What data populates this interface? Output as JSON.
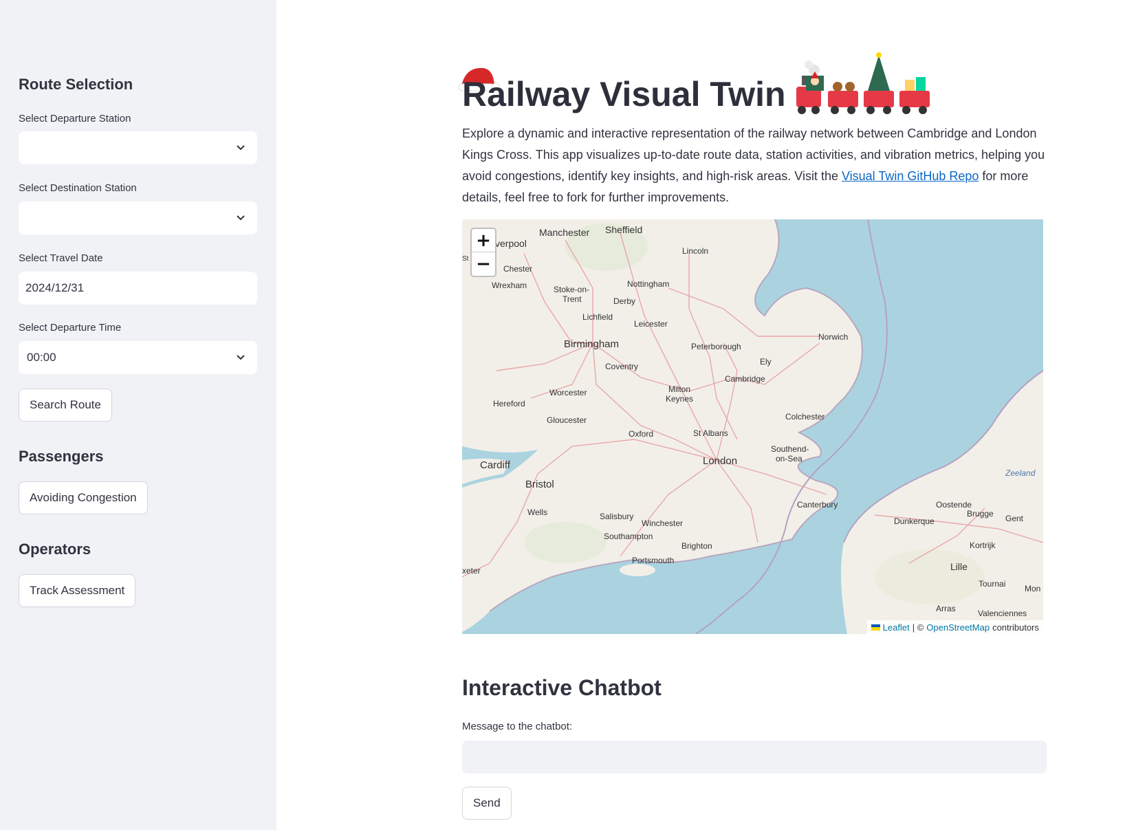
{
  "sidebar": {
    "route_heading": "Route Selection",
    "departure_label": "Select Departure Station",
    "departure_value": "",
    "destination_label": "Select Destination Station",
    "destination_value": "",
    "date_label": "Select Travel Date",
    "date_value": "2024/12/31",
    "time_label": "Select Departure Time",
    "time_value": "00:00",
    "search_button": "Search Route",
    "passengers_heading": "Passengers",
    "congestion_button": "Avoiding Congestion",
    "operators_heading": "Operators",
    "track_button": "Track Assessment"
  },
  "main": {
    "title": "Railway Visual Twin",
    "description_before_link": "Explore a dynamic and interactive representation of the railway network between Cambridge and London Kings Cross. This app visualizes up-to-date route data, station activities, and vibration metrics, helping you avoid congestions, identify key insights, and high-risk areas. Visit the ",
    "link_text": "Visual Twin GitHub Repo",
    "description_after_link": " for more details, feel free to fork for further improvements."
  },
  "map": {
    "zoom_in": "+",
    "zoom_out": "−",
    "attribution_leaflet": "Leaflet",
    "attribution_sep": "| ©",
    "attribution_osm": "OpenStreetMap",
    "attribution_tail": "contributors",
    "labels": {
      "manchester": "Manchester",
      "sheffield": "Sheffield",
      "liverpool": "verpool",
      "lincoln": "Lincoln",
      "chester": "Chester",
      "wrexham": "Wrexham",
      "stoke": "Stoke-on-",
      "stoke2": "Trent",
      "nottingham": "Nottingham",
      "derby": "Derby",
      "lichfield": "Lichfield",
      "leicester": "Leicester",
      "norwich": "Norwich",
      "birmingham": "Birmingham",
      "peterborough": "Peterborough",
      "ely": "Ely",
      "coventry": "Coventry",
      "cambridge": "Cambridge",
      "hereford": "Hereford",
      "worcester": "Worcester",
      "milton": "Milton",
      "keynes": "Keynes",
      "colchester": "Colchester",
      "gloucester": "Gloucester",
      "oxford": "Oxford",
      "stalbans": "St Albans",
      "southend": "Southend-",
      "onsea": "on-Sea",
      "cardiff": "Cardiff",
      "london": "London",
      "zeeland": "Zeeland",
      "bristol": "Bristol",
      "canterbury": "Canterbury",
      "oostende": "Oostende",
      "brugge": "Brugge",
      "wells": "Wells",
      "salisbury": "Salisbury",
      "winchester": "Winchester",
      "dunkerque": "Dunkerque",
      "gent": "Gent",
      "southampton": "Southampton",
      "brighton": "Brighton",
      "kortrijk": "Kortrijk",
      "portsmouth": "Portsmouth",
      "lille": "Lille",
      "exeter": "xeter",
      "tournai": "Tournai",
      "mons": "Mon",
      "arras": "Arras",
      "valenciennes": "Valenciennes",
      "sta": "St A"
    }
  },
  "chat": {
    "heading": "Interactive Chatbot",
    "label": "Message to the chatbot:",
    "value": "",
    "send_button": "Send"
  },
  "colors": {
    "sidebar_bg": "#f0f2f6",
    "link": "#0b67c6",
    "sea": "#aad3df",
    "land": "#f2efe9"
  }
}
